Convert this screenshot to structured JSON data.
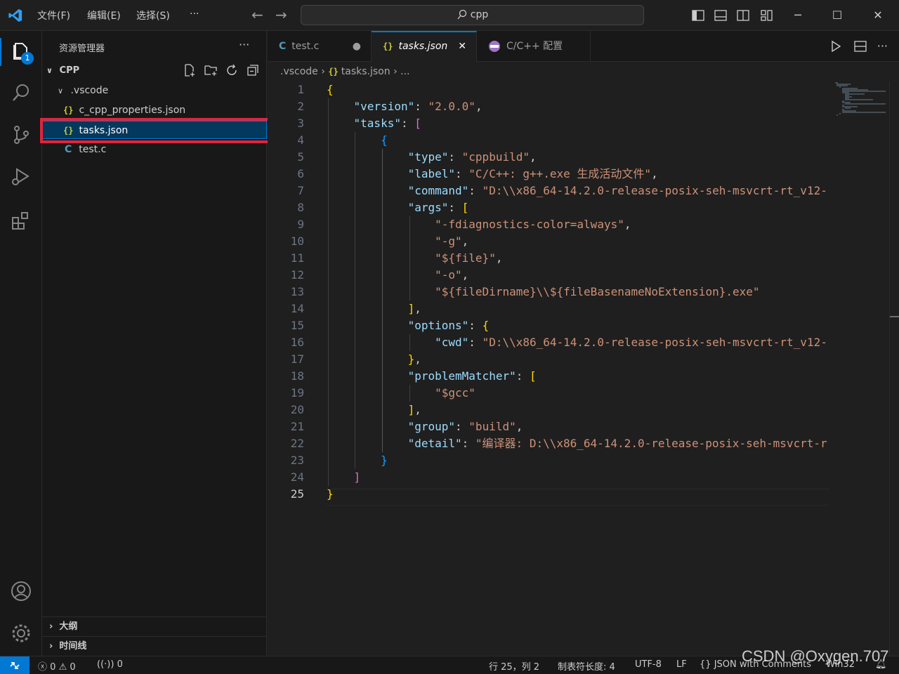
{
  "titlebar": {
    "menu": [
      "文件(F)",
      "编辑(E)",
      "选择(S)",
      "···"
    ],
    "search": "cpp"
  },
  "sidebar": {
    "title": "资源管理器",
    "more": "···",
    "folder": "CPP",
    "tree": [
      {
        "label": ".vscode",
        "type": "folder"
      },
      {
        "label": "c_cpp_properties.json",
        "type": "json"
      },
      {
        "label": "tasks.json",
        "type": "json"
      },
      {
        "label": "test.c",
        "type": "c"
      }
    ],
    "outline": "大纲",
    "timeline": "时间线"
  },
  "activity": {
    "badge": "1"
  },
  "tabs": [
    {
      "label": "test.c",
      "icon": "C"
    },
    {
      "label": "tasks.json",
      "icon": "{}"
    },
    {
      "label": "C/C++ 配置",
      "icon": "C/C++"
    }
  ],
  "breadcrumb": {
    "folder": ".vscode",
    "file": "tasks.json",
    "more": "..."
  },
  "editor": {
    "line_numbers": [
      "1",
      "2",
      "3",
      "4",
      "5",
      "6",
      "7",
      "8",
      "9",
      "10",
      "11",
      "12",
      "13",
      "14",
      "15",
      "16",
      "17",
      "18",
      "19",
      "20",
      "21",
      "22",
      "23",
      "24",
      "25"
    ],
    "lines": {
      "l2k": "\"version\"",
      "l2v": "\"2.0.0\"",
      "l3k": "\"tasks\"",
      "l5k": "\"type\"",
      "l5v": "\"cppbuild\"",
      "l6k": "\"label\"",
      "l6v": "\"C/C++: g++.exe 生成活动文件\"",
      "l7k": "\"command\"",
      "l7v": "\"D:\\\\x86_64-14.2.0-release-posix-seh-msvcrt-rt_v12-",
      "l8k": "\"args\"",
      "l9v": "\"-fdiagnostics-color=always\"",
      "l10v": "\"-g\"",
      "l11v": "\"${file}\"",
      "l12v": "\"-o\"",
      "l13v": "\"${fileDirname}\\\\${fileBasenameNoExtension}.exe\"",
      "l15k": "\"options\"",
      "l16k": "\"cwd\"",
      "l16v": "\"D:\\\\x86_64-14.2.0-release-posix-seh-msvcrt-rt_v12-",
      "l18k": "\"problemMatcher\"",
      "l19v": "\"$gcc\"",
      "l21k": "\"group\"",
      "l21v": "\"build\"",
      "l22k": "\"detail\"",
      "l22v": "\"编译器: D:\\\\x86_64-14.2.0-release-posix-seh-msvcrt-r"
    }
  },
  "statusbar": {
    "errors": "0",
    "warnings": "0",
    "ports": "0",
    "position": "行 25，列 2",
    "tab_size": "制表符长度: 4",
    "encoding": "UTF-8",
    "eol": "LF",
    "language": "JSON with Comments",
    "platform": "Win32"
  },
  "watermark": "CSDN @Oxygen.707",
  "colors": {
    "accent": "#0078d4",
    "highlight_box": "#e0243a"
  }
}
